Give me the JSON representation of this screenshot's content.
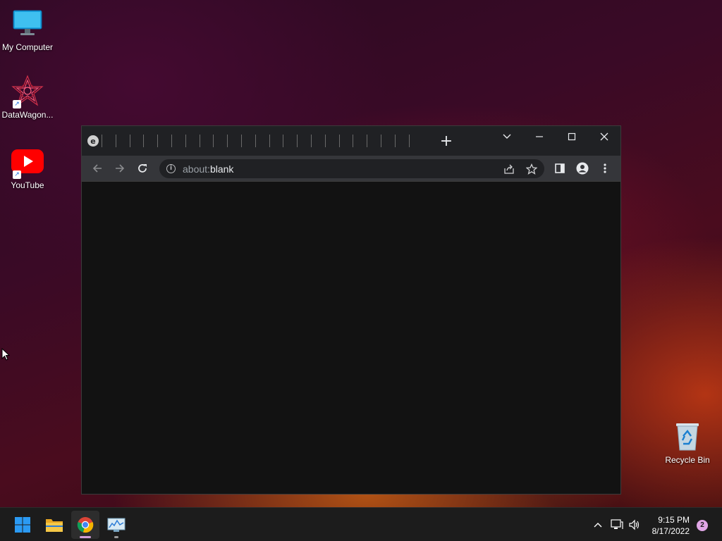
{
  "desktop": {
    "icons": [
      {
        "label": "My Computer",
        "icon": "monitor-icon"
      },
      {
        "label": "DataWagon...",
        "icon": "datawagon-icon"
      },
      {
        "label": "YouTube",
        "icon": "youtube-icon"
      },
      {
        "label": "Recycle Bin",
        "icon": "recycle-bin-icon"
      }
    ]
  },
  "browser": {
    "tab_favicon": "e",
    "new_tab": "+",
    "address": {
      "scheme": "about:",
      "host": "blank"
    },
    "controls": {
      "dropdown": "tab-search-icon",
      "minimize": "minimize-icon",
      "maximize": "maximize-icon",
      "close": "close-icon"
    }
  },
  "taskbar": {
    "apps": [
      "start-icon",
      "file-explorer-icon",
      "chrome-icon",
      "resource-monitor-icon"
    ],
    "clock": {
      "time": "9:15 PM",
      "date": "8/17/2022"
    },
    "notifications": "2"
  },
  "colors": {
    "titlebar": "#202124",
    "toolbar": "#35363a",
    "omnibox": "#202124",
    "content": "#121212",
    "taskbar": "#1c1c1c"
  }
}
